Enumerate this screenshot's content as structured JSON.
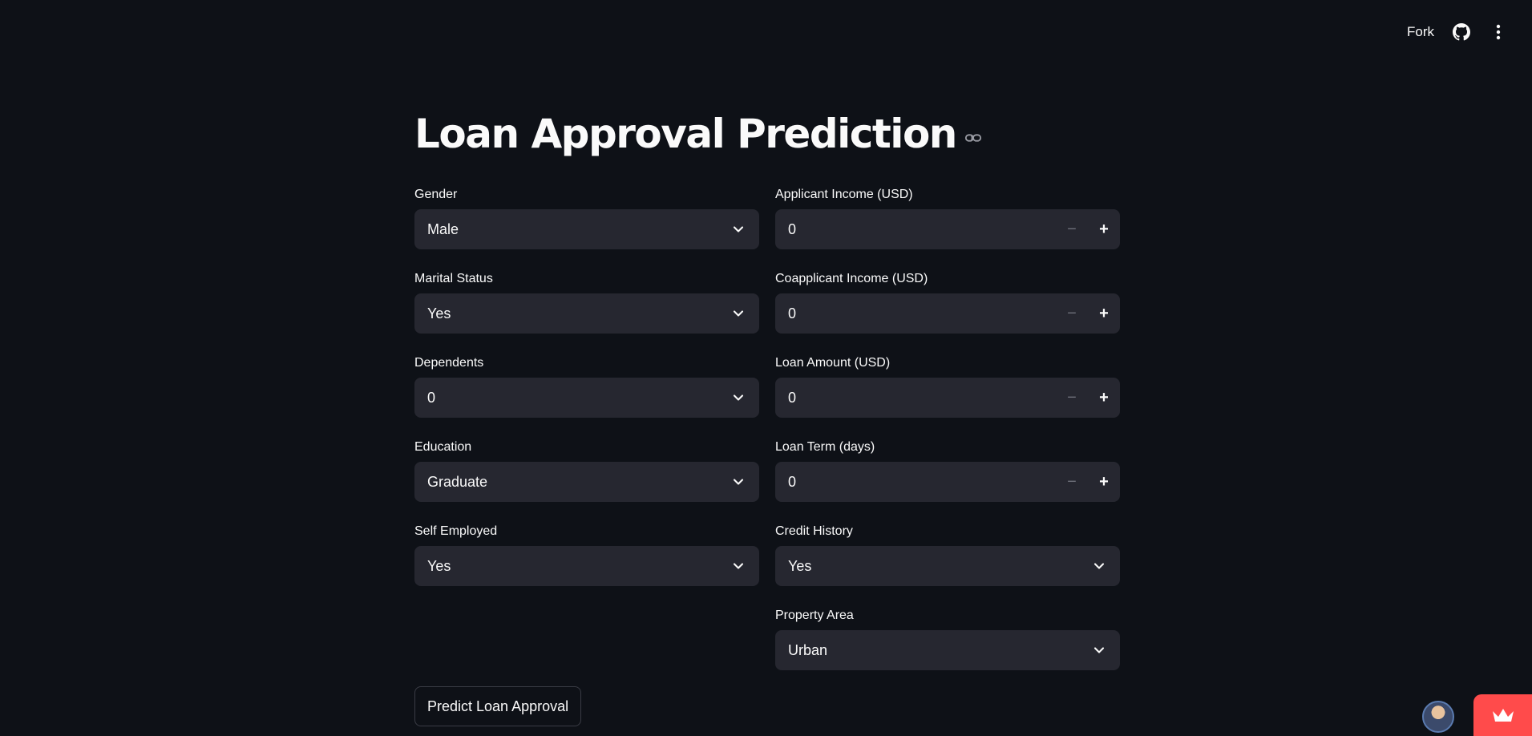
{
  "header": {
    "fork_label": "Fork",
    "github_icon": "github-icon",
    "menu_icon": "more-vertical-icon"
  },
  "title": "Loan Approval Prediction",
  "left_fields": [
    {
      "label": "Gender",
      "value": "Male"
    },
    {
      "label": "Marital Status",
      "value": "Yes"
    },
    {
      "label": "Dependents",
      "value": "0"
    },
    {
      "label": "Education",
      "value": "Graduate"
    },
    {
      "label": "Self Employed",
      "value": "Yes"
    }
  ],
  "right_fields": [
    {
      "label": "Applicant Income (USD)",
      "value": "0"
    },
    {
      "label": "Coapplicant Income (USD)",
      "value": "0"
    },
    {
      "label": "Loan Amount (USD)",
      "value": "0"
    },
    {
      "label": "Loan Term (days)",
      "value": "0"
    },
    {
      "label": "Credit History",
      "value": "Yes"
    },
    {
      "label": "Property Area",
      "value": "Urban"
    }
  ],
  "stepper": {
    "minus": "−",
    "plus": "+"
  },
  "predict_button": "Predict Loan Approval",
  "colors": {
    "accent": "#ff4b4b",
    "background": "#0e1117",
    "input": "#262730"
  }
}
